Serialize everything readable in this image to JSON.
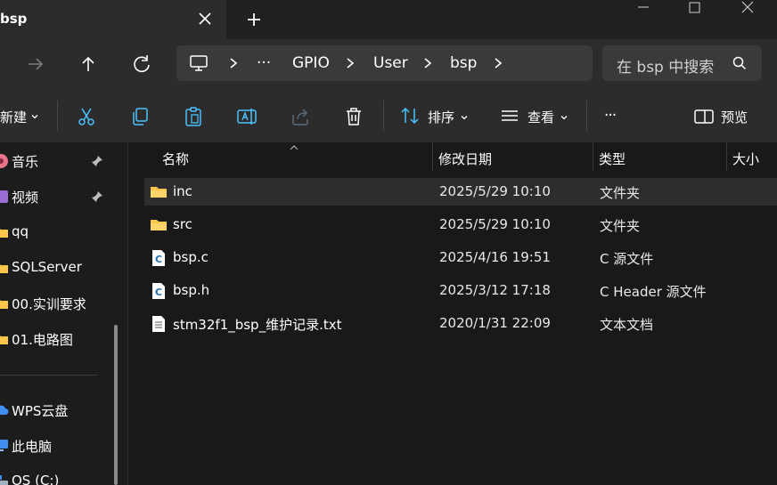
{
  "window": {
    "tab_title": "bsp",
    "colors": {
      "accent": "#4cc2ff",
      "folder": "#f8c64a",
      "bg": "#1c1c1c"
    }
  },
  "address": {
    "crumbs": [
      "···",
      "GPIO",
      "User",
      "bsp"
    ],
    "search_placeholder": "在 bsp 中搜索"
  },
  "toolbar": {
    "new_label": "新建",
    "sort_label": "排序",
    "view_label": "查看",
    "more_label": "···",
    "preview_label": "预览"
  },
  "sidebar": {
    "items": [
      {
        "label": "音乐",
        "icon": "music-icon",
        "pinned": true
      },
      {
        "label": "视频",
        "icon": "video-icon",
        "pinned": true
      },
      {
        "label": "qq",
        "icon": "folder-icon",
        "pinned": false
      },
      {
        "label": "SQLServer",
        "icon": "folder-icon",
        "pinned": false
      },
      {
        "label": "00.实训要求",
        "icon": "folder-icon",
        "pinned": false
      },
      {
        "label": "01.电路图",
        "icon": "folder-icon",
        "pinned": false
      },
      {
        "label": "WPS云盘",
        "icon": "cloud-icon",
        "pinned": false
      },
      {
        "label": "此电脑",
        "icon": "computer-icon",
        "pinned": false
      },
      {
        "label": "OS (C:)",
        "icon": "drive-icon",
        "pinned": false
      }
    ]
  },
  "columns": {
    "name": "名称",
    "date": "修改日期",
    "type": "类型",
    "size": "大小"
  },
  "files": [
    {
      "name": "inc",
      "date": "2025/5/29 10:10",
      "type": "文件夹",
      "icon": "folder-icon",
      "selected": true
    },
    {
      "name": "src",
      "date": "2025/5/29 10:10",
      "type": "文件夹",
      "icon": "folder-icon",
      "selected": false
    },
    {
      "name": "bsp.c",
      "date": "2025/4/16 19:51",
      "type": "C 源文件",
      "icon": "c-file-icon",
      "selected": false
    },
    {
      "name": "bsp.h",
      "date": "2025/3/12 17:18",
      "type": "C Header 源文件",
      "icon": "c-file-icon",
      "selected": false
    },
    {
      "name": "stm32f1_bsp_维护记录.txt",
      "date": "2020/1/31 22:09",
      "type": "文本文档",
      "icon": "text-file-icon",
      "selected": false
    }
  ]
}
